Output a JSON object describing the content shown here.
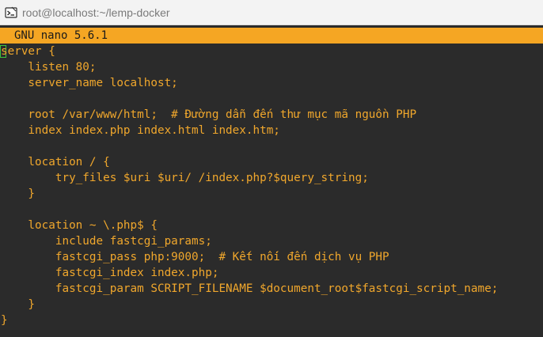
{
  "window": {
    "title": "root@localhost:~/lemp-docker",
    "icon": "terminal-app-icon"
  },
  "nano": {
    "header": "GNU nano 5.6.1"
  },
  "file": {
    "lines": [
      "server {",
      "    listen 80;",
      "    server_name localhost;",
      "",
      "    root /var/www/html;  # Đường dẫn đến thư mục mã nguồn PHP",
      "    index index.php index.html index.htm;",
      "",
      "    location / {",
      "        try_files $uri $uri/ /index.php?$query_string;",
      "    }",
      "",
      "    location ~ \\.php$ {",
      "        include fastcgi_params;",
      "        fastcgi_pass php:9000;  # Kết nối đến dịch vụ PHP",
      "        fastcgi_index index.php;",
      "        fastcgi_param SCRIPT_FILENAME $document_root$fastcgi_script_name;",
      "    }",
      "}"
    ]
  },
  "colors": {
    "text": "#f0a72c",
    "header_bg": "#f5a623",
    "editor_bg": "#2b2b2b",
    "cursor": "#3cc43c"
  }
}
